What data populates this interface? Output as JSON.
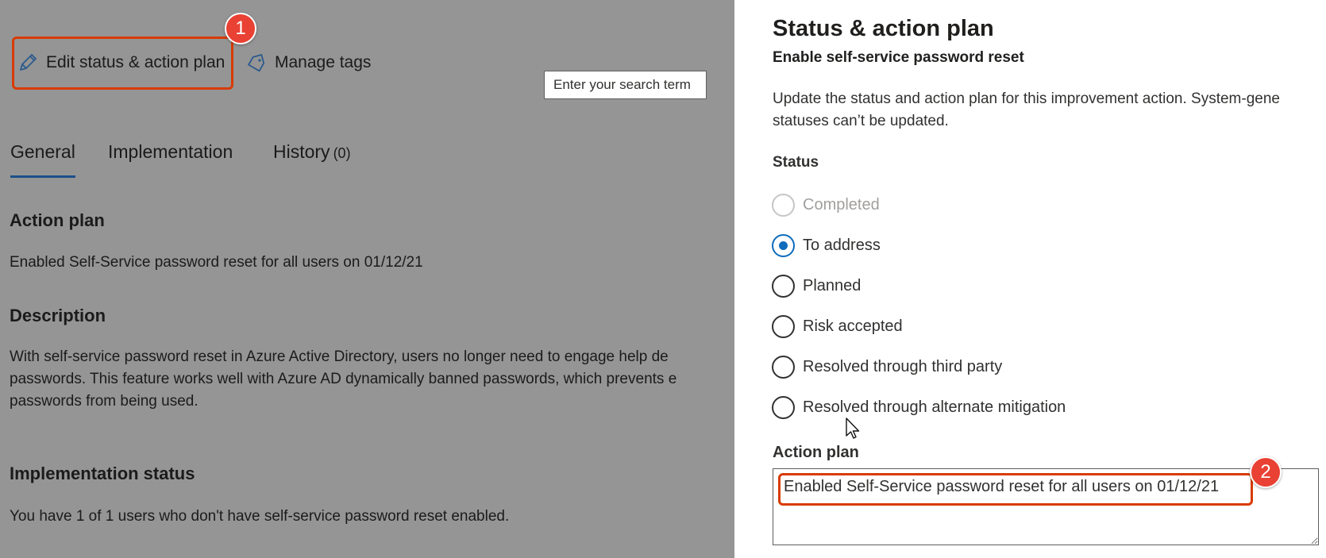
{
  "toolbar": {
    "edit_label": "Edit status & action plan",
    "tags_label": "Manage tags"
  },
  "callouts": {
    "one": "1",
    "two": "2"
  },
  "search_tooltip": "Enter your search term",
  "tabs": [
    {
      "label": "General",
      "selected": true
    },
    {
      "label": "Implementation"
    },
    {
      "label": "History",
      "count": "(0)"
    }
  ],
  "details": {
    "action_plan_heading": "Action plan",
    "action_plan_text": "Enabled Self-Service password reset for all users on 01/12/21",
    "description_heading": "Description",
    "description_lines": [
      "With self-service password reset in Azure Active Directory, users no longer need to engage help de",
      "passwords. This feature works well with Azure AD dynamically banned passwords, which prevents e",
      "passwords from being used."
    ],
    "implementation_heading": "Implementation status",
    "implementation_text": "You have 1 of 1 users who don't have self-service password reset enabled."
  },
  "panel": {
    "title": "Status & action plan",
    "subtitle": "Enable self-service password reset",
    "description_lines": [
      "Update the status and action plan for this improvement action. System-gene",
      "statuses can’t be updated."
    ],
    "status_label": "Status",
    "options": [
      {
        "label": "Completed",
        "state": "disabled"
      },
      {
        "label": "To address",
        "state": "checked"
      },
      {
        "label": "Planned",
        "state": "unchecked"
      },
      {
        "label": "Risk accepted",
        "state": "unchecked"
      },
      {
        "label": "Resolved through third party",
        "state": "unchecked"
      },
      {
        "label": "Resolved through alternate mitigation",
        "state": "unchecked"
      }
    ],
    "action_plan_label": "Action plan",
    "action_plan_value": "Enabled Self-Service password reset for all users on 01/12/21"
  },
  "colors": {
    "overlay_bg": "#959595",
    "accent": "#0f6cbd",
    "callout": "#e94133"
  }
}
